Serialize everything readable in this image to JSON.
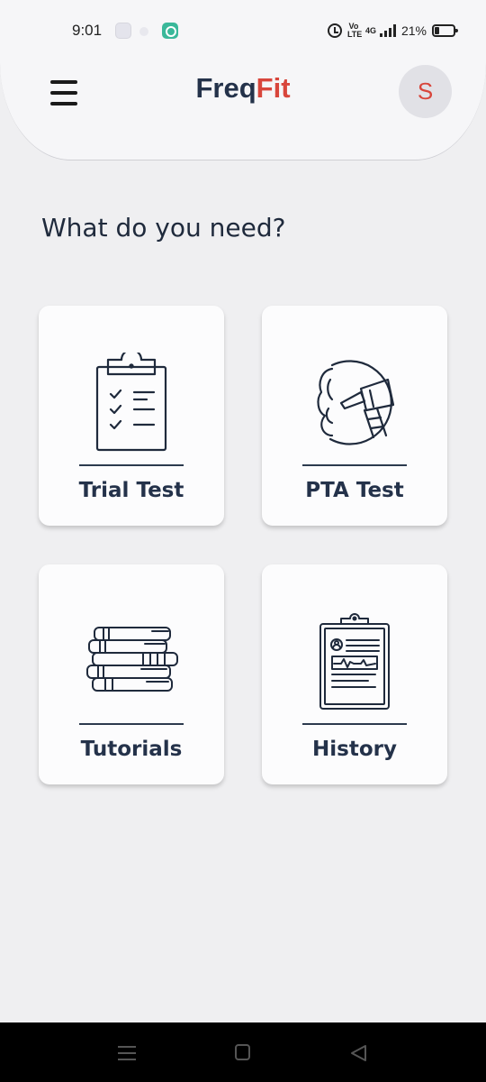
{
  "status_bar": {
    "time": "9:01",
    "volte": "Vo LTE",
    "network": "4G",
    "battery": "21%"
  },
  "header": {
    "brand_part1": "Freq",
    "brand_part2": "Fit",
    "avatar_initial": "S",
    "brand_color": "#24324a",
    "accent_color": "#d8463c"
  },
  "main": {
    "question": "What do you need?",
    "cards": [
      {
        "label": "Trial Test",
        "icon": "clipboard-checklist-icon"
      },
      {
        "label": "PTA Test",
        "icon": "otoscope-ear-icon"
      },
      {
        "label": "Tutorials",
        "icon": "books-stack-icon"
      },
      {
        "label": "History",
        "icon": "medical-record-icon"
      }
    ]
  },
  "nav": {
    "icons": [
      "recent-apps-icon",
      "home-icon",
      "back-icon"
    ]
  }
}
